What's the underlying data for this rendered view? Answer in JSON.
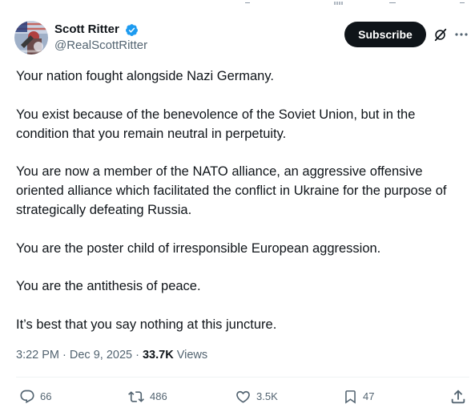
{
  "author": {
    "display_name": "Scott Ritter",
    "handle": "@RealScottRitter",
    "verified": true
  },
  "header": {
    "subscribe_label": "Subscribe",
    "grok_icon": "grok-icon",
    "more_icon": "more-horizontal-icon"
  },
  "tweet": {
    "paragraphs": [
      "Your nation fought alongside Nazi Germany.",
      "You exist because of the benevolence of the Soviet Union, but in the condition that you remain neutral in perpetuity.",
      "You are now a member of the NATO alliance, an aggressive offensive oriented alliance which facilitated the conflict in Ukraine for the purpose of strategically defeating Russia.",
      "You are the poster child of irresponsible European aggression.",
      "You are the antithesis of peace.",
      "It’s best that you say nothing at this juncture."
    ]
  },
  "meta": {
    "time": "3:22 PM",
    "separator": " · ",
    "date": "Dec 9, 2025",
    "views_count": "33.7K",
    "views_label": " Views"
  },
  "actions": {
    "replies": "66",
    "reposts": "486",
    "likes": "3.5K",
    "bookmarks": "47"
  },
  "colors": {
    "text_primary": "#0f1419",
    "text_secondary": "#536471",
    "verified_blue": "#1d9bf0",
    "divider": "#eff3f4",
    "button_bg": "#0f1419"
  }
}
